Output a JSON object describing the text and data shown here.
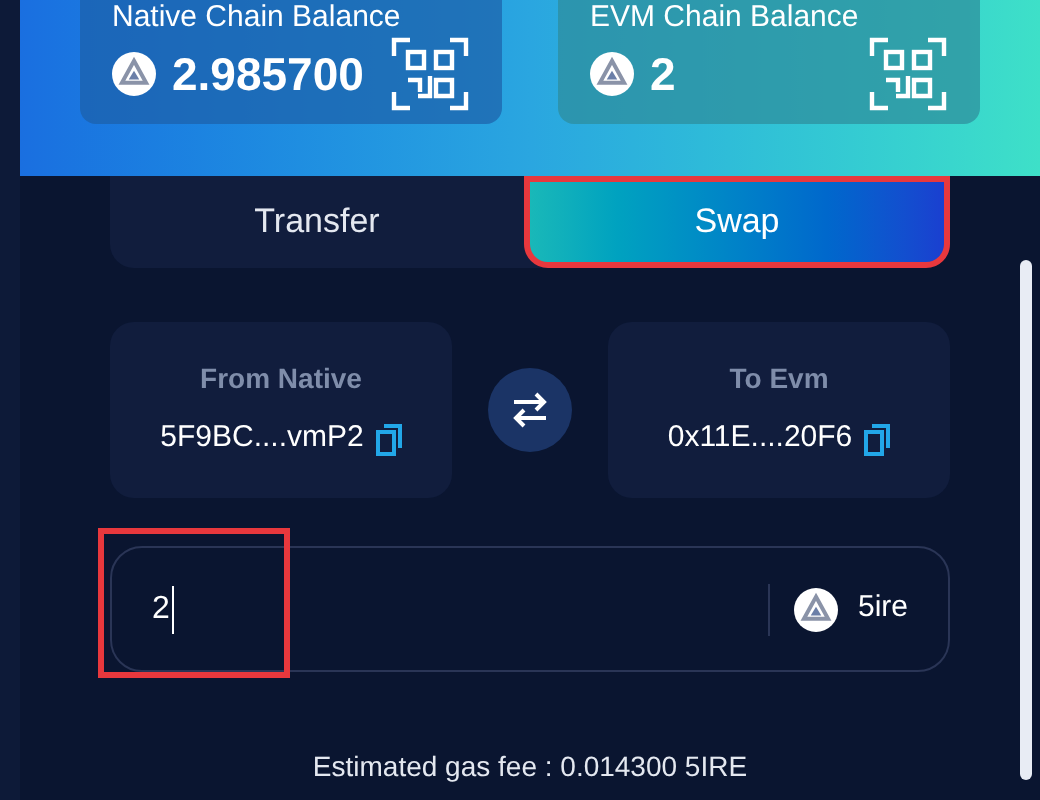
{
  "balances": [
    {
      "label": "Native Chain Balance",
      "amount": "2.985700"
    },
    {
      "label": "EVM Chain Balance",
      "amount": "2"
    }
  ],
  "tabs": [
    {
      "label": "Transfer",
      "selected": false,
      "highlighted": false
    },
    {
      "label": "Swap",
      "selected": true,
      "highlighted": true
    }
  ],
  "from": {
    "label": "From Native",
    "address": "5F9BC....vmP2"
  },
  "to": {
    "label": "To Evm",
    "address": "0x11E....20F6"
  },
  "amount": {
    "value": "2",
    "highlighted": true,
    "token": "5ire"
  },
  "gas_fee": "Estimated gas fee : 0.014300 5IRE"
}
